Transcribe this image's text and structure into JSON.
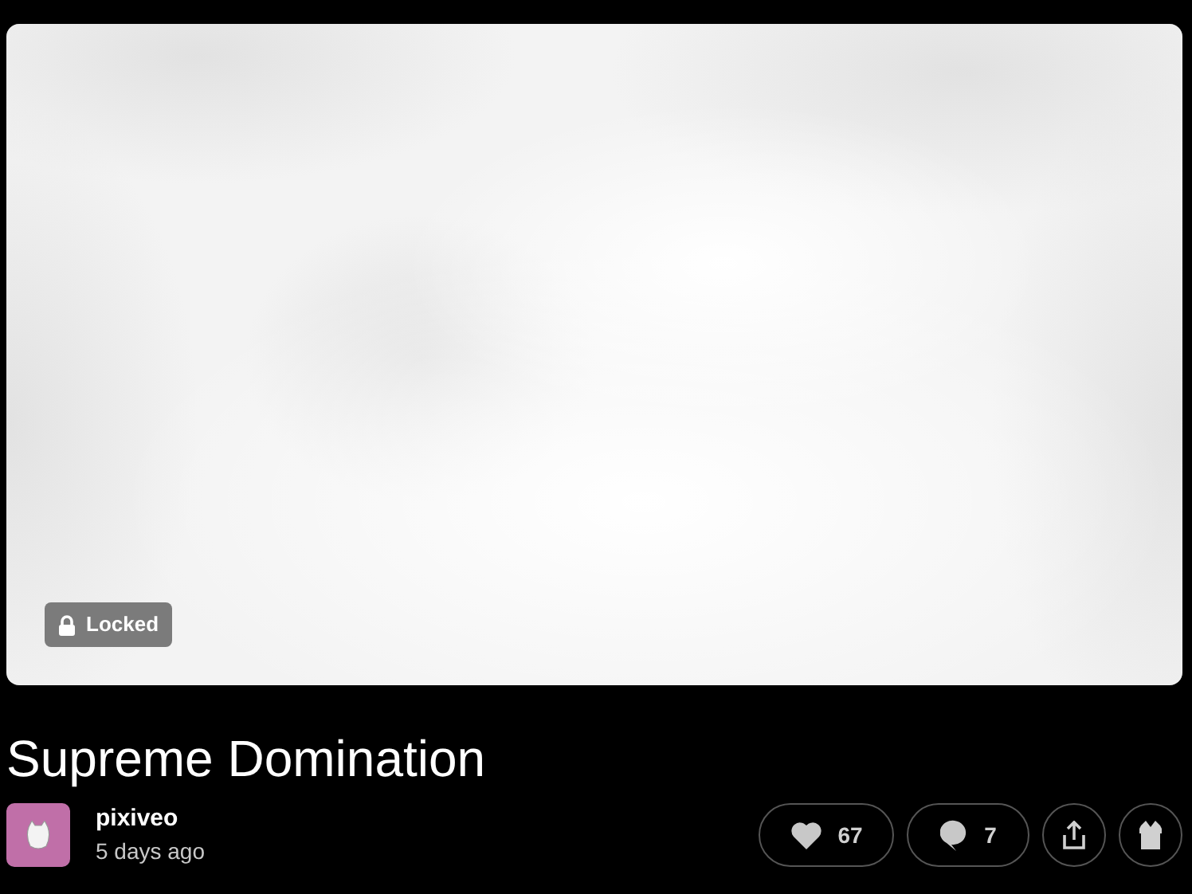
{
  "media": {
    "kind": "picture",
    "badge": {
      "label": "Locked"
    }
  },
  "post": {
    "title": "Supreme Domination",
    "author": "pixiveo",
    "time": "5 days ago"
  },
  "actions": {
    "likes": "67",
    "comments": "7"
  }
}
